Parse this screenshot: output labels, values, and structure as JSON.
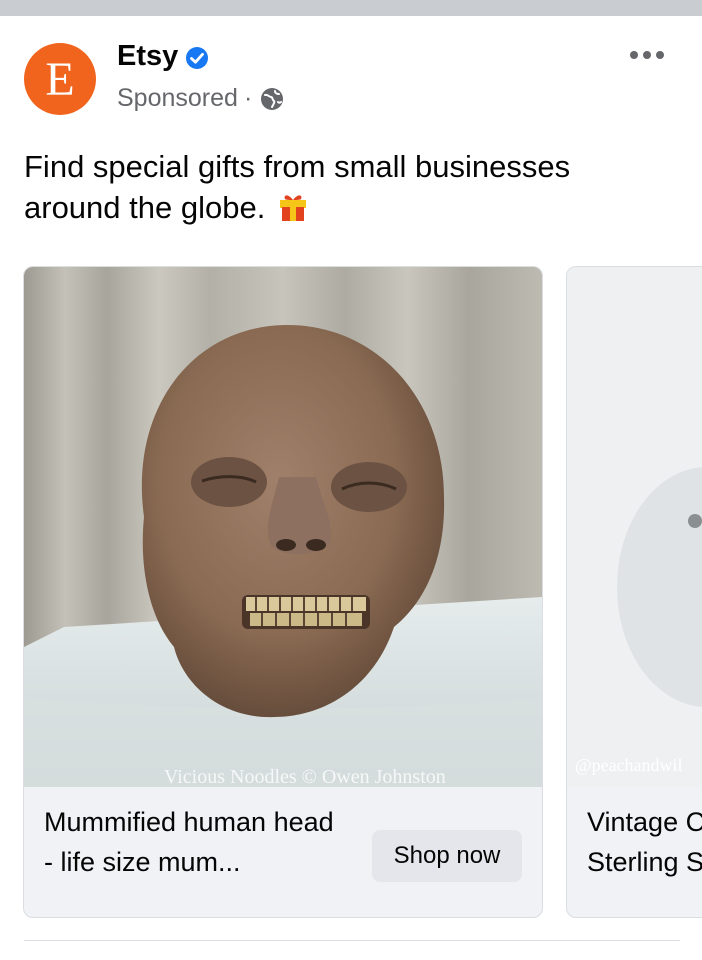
{
  "post": {
    "author": "Etsy",
    "avatar_letter": "E",
    "sponsored": "Sponsored",
    "separator": "·",
    "caption": "Find special gifts from small businesses around the globe."
  },
  "icons": {
    "verified": "verified-badge-icon",
    "audience": "globe-icon",
    "more": "more-options-icon",
    "gift": "gift-emoji-icon"
  },
  "colors": {
    "brand": "#f1641e",
    "verified_blue": "#1877f2",
    "secondary_text": "#65676b"
  },
  "carousel": [
    {
      "title": "Mummified human head - life size mum...",
      "button": "Shop now",
      "watermark": "Vicious Noodles   © Owen Johnston"
    },
    {
      "title_line1": "Vintage C",
      "title_line2": "Sterling S",
      "watermark": "@peachandwil"
    }
  ]
}
